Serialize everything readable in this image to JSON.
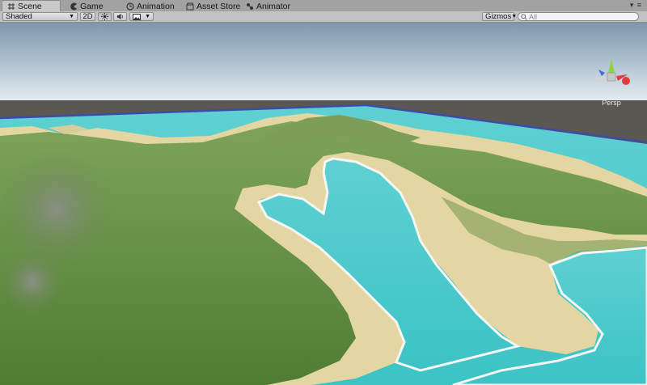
{
  "tabs": [
    {
      "label": "Scene",
      "icon": "hash-grid-icon",
      "active": true
    },
    {
      "label": "Game",
      "icon": "pacman-icon",
      "active": false
    },
    {
      "label": "Animation",
      "icon": "clock-icon",
      "active": false
    },
    {
      "label": "Asset Store",
      "icon": "store-icon",
      "active": false
    },
    {
      "label": "Animator",
      "icon": "animator-icon",
      "active": false
    }
  ],
  "toolbar": {
    "shading_mode": "Shaded",
    "mode_2d": "2D",
    "gizmos_label": "Gizmos",
    "search_placeholder": "All",
    "lighting_icon": "sun-icon",
    "audio_icon": "speaker-icon",
    "effects_icon": "image-icon"
  },
  "gizmo": {
    "projection_label": "Persp"
  },
  "colors": {
    "sky_top": "#7e98ad",
    "horizon": "#dde7ee",
    "ground": "#595551",
    "water": "#4bc8c8",
    "sand": "#e6d9a8",
    "grass": "#5d8a3e",
    "bounds": "#3d4ba8"
  }
}
